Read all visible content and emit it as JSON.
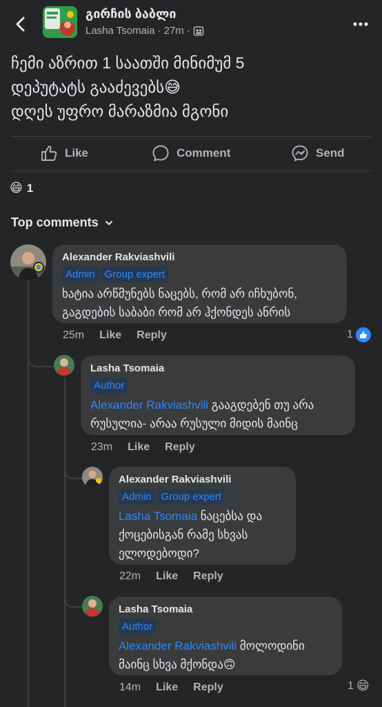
{
  "header": {
    "group_name": "გირჩის ბაბლი",
    "author": "Lasha Tsomaia",
    "time": "27m"
  },
  "post": {
    "text_line1": "ჩემი აზრით 1 საათში მინიმუმ 5",
    "text_line2": "დეპუტატს გააძევებს😅",
    "text_line3": "დღეს უფრო მარაზმია მგონი"
  },
  "actions": {
    "like": "Like",
    "comment": "Comment",
    "send": "Send"
  },
  "reactions": {
    "emoji": "😄",
    "count": "1"
  },
  "comments_filter": "Top comments",
  "comments": [
    {
      "author": "Alexander Rakviashvili",
      "badges": [
        "Admin",
        "Group expert"
      ],
      "text_line1": "ხატია არწმუნებს ნაცებს, რომ არ იჩხუბონ,",
      "text_line2": "გაგდების საბაბი რომ არ ჰქონდეს ანრის",
      "time": "25m",
      "like": "Like",
      "reply": "Reply",
      "reaction_count": "1"
    },
    {
      "author": "Lasha Tsomaia",
      "badges": [
        "Author"
      ],
      "mention": "Alexander Rakviashvili",
      "text_line1_rest": " გააგდებენ თუ არა",
      "text_line2": "რუსულია- არაა რუსული მიდის მაინც",
      "time": "23m",
      "like": "Like",
      "reply": "Reply"
    },
    {
      "author": "Alexander Rakviashvili",
      "badges": [
        "Admin",
        "Group expert"
      ],
      "mention": "Lasha Tsomaia",
      "text_line1_rest": " ნაცებსა და",
      "text_line2": "ქოცებისგან რამე სხვას",
      "text_line3": "ელოდებოდი?",
      "time": "22m",
      "like": "Like",
      "reply": "Reply"
    },
    {
      "author": "Lasha Tsomaia",
      "badges": [
        "Author"
      ],
      "mention": "Alexander Rakviashvili",
      "text_line1_rest": " მოლოდინი",
      "text_line2": "მაინც სხვა მქონდა🙃",
      "time": "14m",
      "like": "Like",
      "reply": "Reply",
      "reaction_count": "1",
      "reaction_emoji": "😄"
    }
  ],
  "colors": {
    "background": "#242526",
    "bubble": "#3a3b3c",
    "accent": "#2d88ff",
    "muted": "#b0b3b8"
  },
  "icons": [
    "back-arrow-icon",
    "more-icon",
    "group-visibility-icon",
    "like-thumb-icon",
    "comment-bubble-icon",
    "messenger-icon",
    "chevron-down-icon"
  ]
}
